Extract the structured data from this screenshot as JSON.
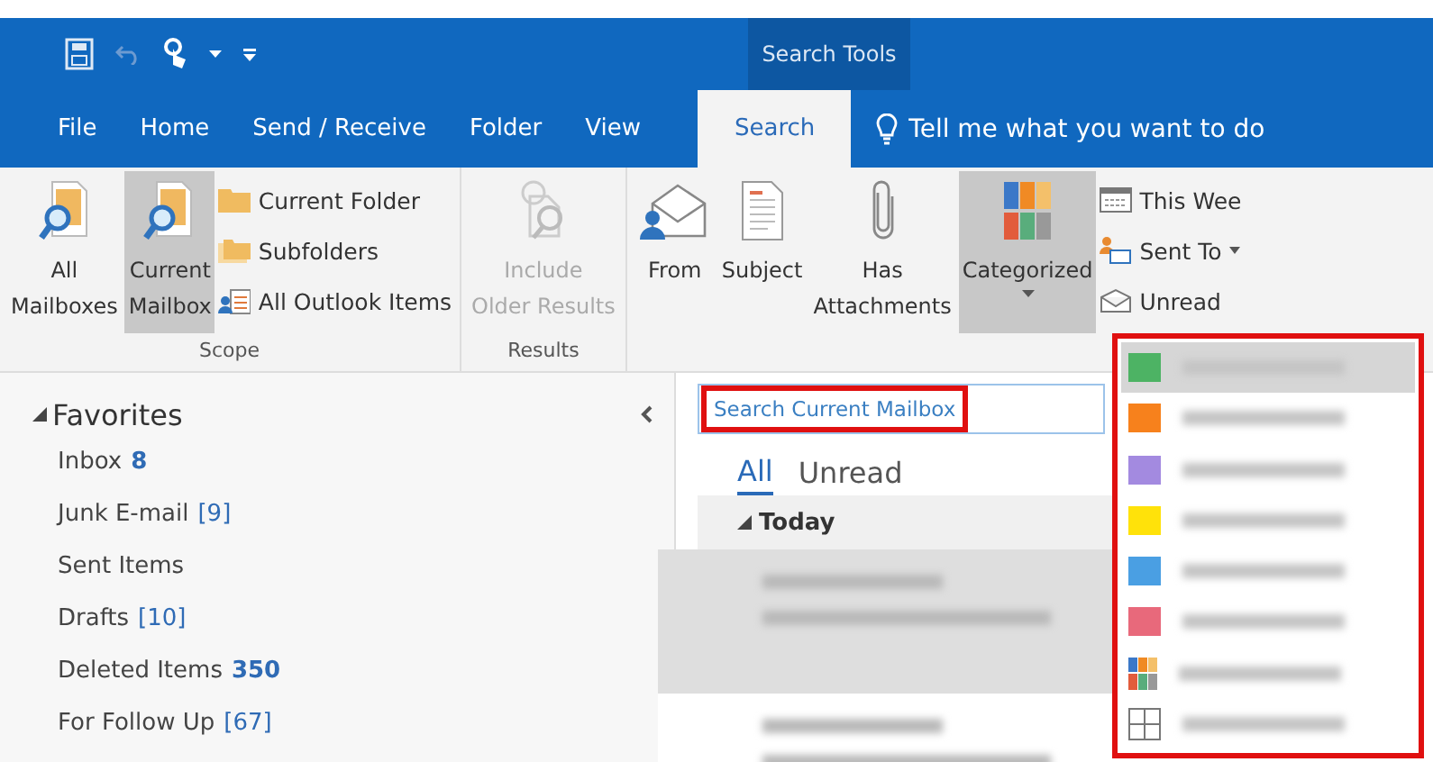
{
  "contextual_tab_group": {
    "label": "Search Tools"
  },
  "tabs": [
    {
      "label": "File",
      "selected": false
    },
    {
      "label": "Home",
      "selected": false
    },
    {
      "label": "Send / Receive",
      "selected": false
    },
    {
      "label": "Folder",
      "selected": false
    },
    {
      "label": "View",
      "selected": false
    },
    {
      "label": "Search",
      "selected": true
    }
  ],
  "tell_me": {
    "placeholder": "Tell me what you want to do"
  },
  "ribbon": {
    "groups": [
      {
        "label": "Scope",
        "large": [
          {
            "lines": [
              "All",
              "Mailboxes"
            ],
            "kind": "mailbox",
            "selected": false,
            "disabled": false
          },
          {
            "lines": [
              "Current",
              "Mailbox"
            ],
            "kind": "mailbox",
            "selected": true,
            "disabled": false
          }
        ],
        "small": [
          {
            "label": "Current Folder",
            "kind": "folder"
          },
          {
            "label": "Subfolders",
            "kind": "folders"
          },
          {
            "label": "All Outlook Items",
            "kind": "items"
          }
        ]
      },
      {
        "label": "Results",
        "large": [
          {
            "lines": [
              "Include",
              "Older Results"
            ],
            "kind": "older",
            "selected": false,
            "disabled": true
          }
        ]
      },
      {
        "large": [
          {
            "lines": [
              "From"
            ],
            "kind": "from",
            "selected": false,
            "disabled": false
          },
          {
            "lines": [
              "Subject"
            ],
            "kind": "subject",
            "selected": false,
            "disabled": false
          },
          {
            "lines": [
              "Has",
              "Attachments"
            ],
            "kind": "clip",
            "selected": false,
            "disabled": false
          },
          {
            "lines": [
              "Categorized"
            ],
            "kind": "categories",
            "selected": true,
            "disabled": false,
            "dropdown": true
          }
        ],
        "small": [
          {
            "label": "This Wee",
            "kind": "calendar"
          },
          {
            "label": "Sent To",
            "kind": "people",
            "dropdown": true
          },
          {
            "label": "Unread",
            "kind": "envelope"
          }
        ]
      }
    ]
  },
  "folder_pane": {
    "header": "Favorites",
    "expanded": true,
    "folders": [
      {
        "name": "Inbox",
        "count": "8",
        "kind": "unread"
      },
      {
        "name": "Junk E-mail",
        "count": "[9]",
        "kind": "total"
      },
      {
        "name": "Sent Items"
      },
      {
        "name": "Drafts",
        "count": "[10]",
        "kind": "total"
      },
      {
        "name": "Deleted Items",
        "count": "350",
        "kind": "unread"
      },
      {
        "name": "For Follow Up",
        "count": "[67]",
        "kind": "total"
      }
    ]
  },
  "search": {
    "placeholder": "Search Current Mailbox"
  },
  "filters": [
    {
      "label": "All",
      "selected": true
    },
    {
      "label": "Unread",
      "selected": false
    }
  ],
  "mail_list": {
    "group": "Today",
    "expanded": true,
    "messages": [
      {
        "selected": true
      },
      {
        "selected": false
      }
    ]
  },
  "category_menu": {
    "items": [
      {
        "kind": "color",
        "color": "#4db364",
        "selected": true
      },
      {
        "kind": "color",
        "color": "#f7811c",
        "selected": false
      },
      {
        "kind": "color",
        "color": "#a38ae0",
        "selected": false
      },
      {
        "kind": "color",
        "color": "#ffe20a",
        "selected": false
      },
      {
        "kind": "color",
        "color": "#4a9fe3",
        "selected": false
      },
      {
        "kind": "color",
        "color": "#e8697b",
        "selected": false
      },
      {
        "kind": "all",
        "selected": false
      },
      {
        "kind": "none",
        "selected": false
      }
    ]
  }
}
